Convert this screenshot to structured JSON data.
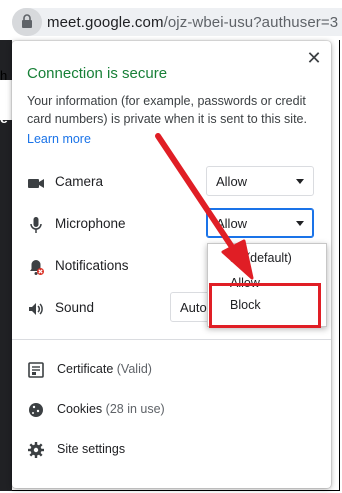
{
  "address_bar": {
    "url_host": "meet.google.com",
    "url_path": "/ojz-wbei-usu?authuser=3"
  },
  "page_peek": {
    "partial_letter_top": "h",
    "partial_letter_dark": "e"
  },
  "popup": {
    "title": "Connection is secure",
    "description": "Your information (for example, passwords or credit card numbers) is private when it is sent to this site.",
    "learn_more": "Learn more",
    "close_glyph": "✕",
    "permissions": [
      {
        "label": "Camera",
        "value": "Allow",
        "icon": "camera-icon"
      },
      {
        "label": "Microphone",
        "value": "Allow",
        "icon": "microphone-icon"
      },
      {
        "label": "Notifications",
        "value": "",
        "icon": "notifications-blocked-icon"
      },
      {
        "label": "Sound",
        "value": "Autom",
        "icon": "speaker-icon"
      }
    ],
    "links": [
      {
        "label": "Certificate",
        "sub": "(Valid)",
        "icon": "certificate-icon"
      },
      {
        "label": "Cookies",
        "sub": "(28 in use)",
        "icon": "cookie-icon"
      },
      {
        "label": "Site settings",
        "sub": "",
        "icon": "gear-icon"
      }
    ]
  },
  "dropdown": {
    "options": [
      "Ask (default)",
      "Allow",
      "Block"
    ],
    "visible_text": [
      "sk (default)",
      "Allow",
      "Block"
    ]
  },
  "colors": {
    "secure_green": "#188038",
    "link_blue": "#1a73e8",
    "annotation_red": "#e01e25"
  }
}
